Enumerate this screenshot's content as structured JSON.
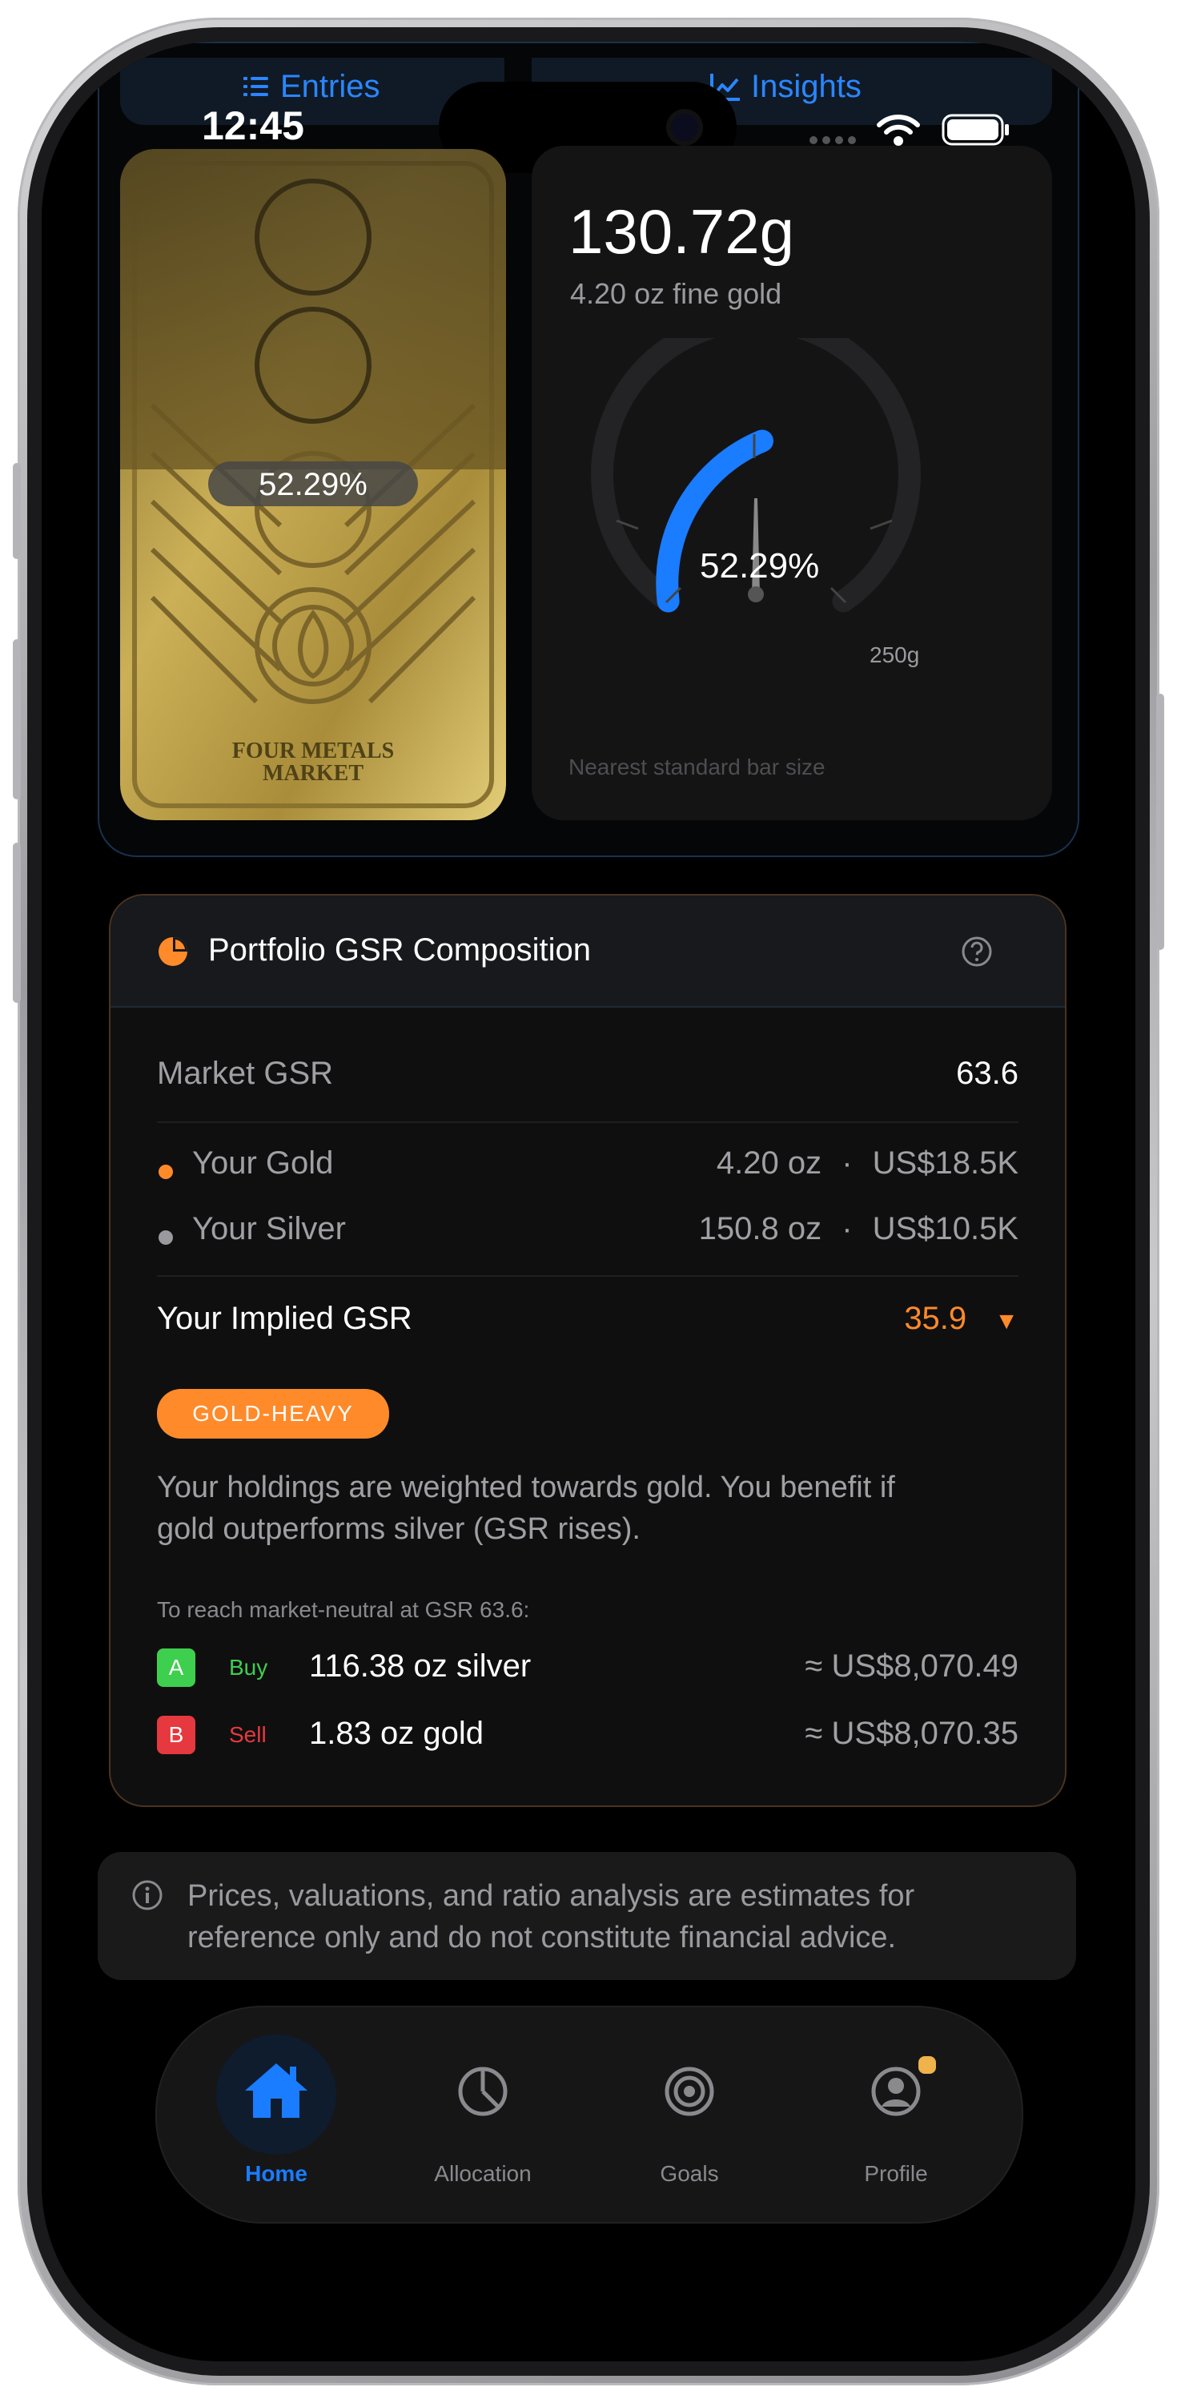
{
  "status_bar": {
    "time": "12:45"
  },
  "tabs": {
    "entries": "Entries",
    "insights": "Insights"
  },
  "gold_bar": {
    "percent": "52.29%",
    "fill_fraction": 0.5229,
    "engraving_line1": "FOUR METALS",
    "engraving_line2": "MARKET"
  },
  "gauge": {
    "weight": "130.72g",
    "fine_gold": "4.20 oz fine gold",
    "percent_label": "52.29%",
    "progress_fraction": 0.5229,
    "max_label": "250g",
    "caption": "Nearest standard bar size"
  },
  "gsr": {
    "title": "Portfolio GSR Composition",
    "market_label": "Market GSR",
    "market_value": "63.6",
    "gold_label": "Your Gold",
    "gold_qty": "4.20 oz",
    "gold_value": "US$18.5K",
    "silver_label": "Your Silver",
    "silver_qty": "150.8 oz",
    "silver_value": "US$10.5K",
    "separator": "·",
    "implied_label": "Your Implied GSR",
    "implied_value": "35.9",
    "implied_arrow": "▼",
    "badge": "GOLD-HEAVY",
    "desc_line1": "Your holdings are weighted towards gold. You benefit if",
    "desc_line2": "gold outperforms silver (GSR rises).",
    "neutral_label": "To reach market-neutral at GSR 63.6:",
    "actions": [
      {
        "letter": "A",
        "verb": "Buy",
        "amount": "116.38 oz silver",
        "value": "≈ US$8,070.49"
      },
      {
        "letter": "B",
        "verb": "Sell",
        "amount": "1.83 oz gold",
        "value": "≈ US$8,070.35"
      }
    ]
  },
  "disclaimer": {
    "line1": "Prices, valuations, and ratio analysis are estimates for",
    "line2": "reference only and do not constitute financial advice."
  },
  "nav": [
    {
      "label": "Home",
      "icon": "home-icon",
      "active": true
    },
    {
      "label": "Allocation",
      "icon": "pie-chart-icon",
      "active": false
    },
    {
      "label": "Goals",
      "icon": "target-icon",
      "active": false
    },
    {
      "label": "Profile",
      "icon": "profile-icon",
      "active": false
    }
  ],
  "colors": {
    "accent_blue": "#1a7cff",
    "accent_orange": "#ff8a2a",
    "buy_green": "#3ecf4f",
    "sell_red": "#e5393f",
    "gold": "#c9a84a"
  }
}
